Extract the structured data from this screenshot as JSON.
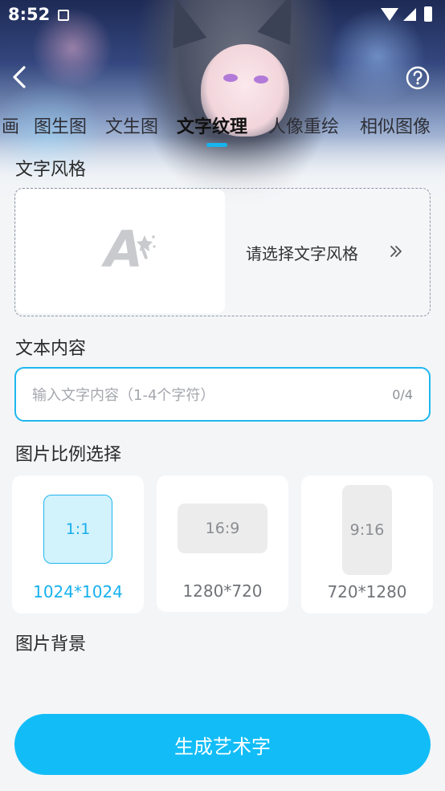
{
  "status_bar": {
    "time": "8:52"
  },
  "tabs": [
    {
      "label": "画",
      "active": false
    },
    {
      "label": "图生图",
      "active": false
    },
    {
      "label": "文生图",
      "active": false
    },
    {
      "label": "文字纹理",
      "active": true
    },
    {
      "label": "人像重绘",
      "active": false
    },
    {
      "label": "相似图像",
      "active": false
    }
  ],
  "sections": {
    "text_style": "文字风格",
    "text_content": "文本内容",
    "ratio": "图片比例选择",
    "background": "图片背景"
  },
  "style_picker": {
    "label": "请选择文字风格",
    "preview_glyph": "A"
  },
  "text_input": {
    "placeholder": "输入文字内容（1-4个字符）",
    "counter": "0/4"
  },
  "ratios": [
    {
      "ratio": "1:1",
      "size": "1024*1024",
      "selected": true
    },
    {
      "ratio": "16:9",
      "size": "1280*720",
      "selected": false
    },
    {
      "ratio": "9:16",
      "size": "720*1280",
      "selected": false
    }
  ],
  "generate_button": {
    "label": "生成艺术字"
  },
  "colors": {
    "accent": "#12bdf7",
    "selected_fill": "#d2f2fc",
    "background": "#f3f5f7"
  }
}
